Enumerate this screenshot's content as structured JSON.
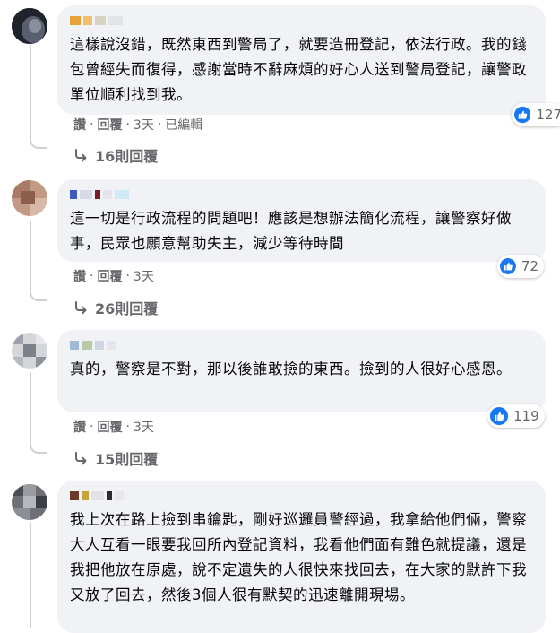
{
  "colors": {
    "bubble_bg": "#f0f2f5",
    "meta_text": "#65676b",
    "like_blue": "#1877f2",
    "thread_line": "#ced0d4"
  },
  "comments": [
    {
      "author_blurred": true,
      "text": "這樣說沒錯，既然東西到警局了，就要造冊登記，依法行政。我的錢包曾經失而復得，感謝當時不辭麻煩的好心人送到警局登記，讓警政單位順利找到我。",
      "like_label": "讚",
      "reply_label": "回覆",
      "time": "3天",
      "edited": "已編輯",
      "reactions": "127",
      "reaction_icon": "like-icon",
      "replies_label": "16則回覆"
    },
    {
      "author_blurred": true,
      "text": "這一切是行政流程的問題吧！應該是想辦法簡化流程，讓警察好做事，民眾也願意幫助失主，減少等待時間",
      "like_label": "讚",
      "reply_label": "回覆",
      "time": "3天",
      "reactions": "72",
      "reaction_icon": "like-icon",
      "replies_label": "26則回覆"
    },
    {
      "author_blurred": true,
      "text": "真的，警察是不對，那以後誰敢撿的東西。撿到的人很好心感恩。",
      "like_label": "讚",
      "reply_label": "回覆",
      "time": "3天",
      "reactions": "119",
      "reaction_icon": "like-icon",
      "replies_label": "15則回覆"
    },
    {
      "author_blurred": true,
      "text": "我上次在路上撿到串鑰匙，剛好巡邏員警經過，我拿給他們倆，警察大人互看一眼要我回所內登記資料，我看他們面有難色就提議，還是我把他放在原處，說不定遺失的人很快來找回去，在大家的默許下我又放了回去，然後3個人很有默契的迅速離開現場。"
    }
  ]
}
